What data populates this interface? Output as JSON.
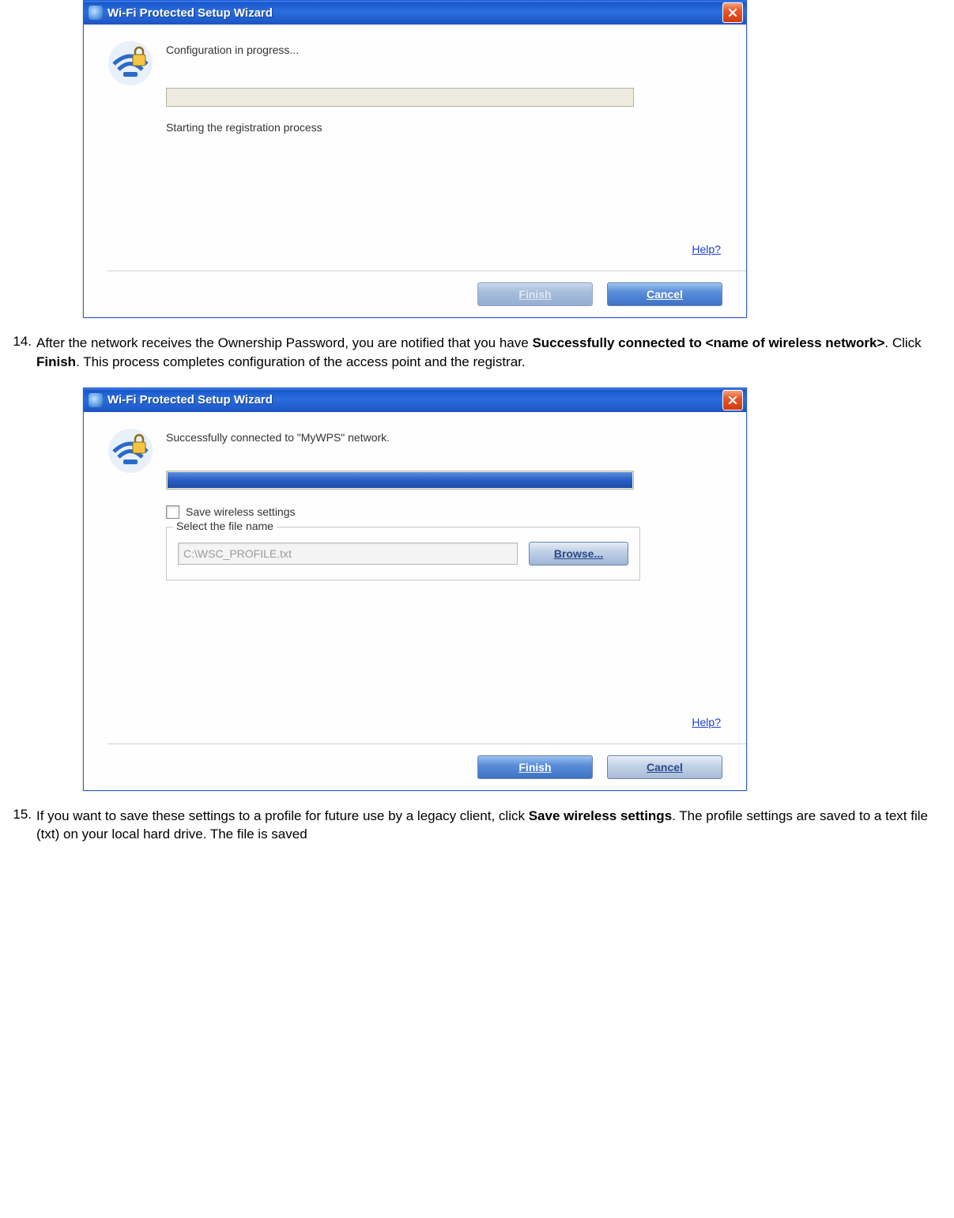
{
  "window1": {
    "title": "Wi-Fi Protected Setup Wizard",
    "message": "Configuration in progress...",
    "status": "Starting the registration process",
    "help": "Help?",
    "finish": "Finish",
    "cancel": "Cancel"
  },
  "step14": {
    "num": "14.",
    "text_before": "After the network receives the Ownership Password, you are notified that you have ",
    "bold1": "Successfully connected to <name of wireless network>",
    "text_mid": ". Click ",
    "bold2": "Finish",
    "text_after": ". This process completes configuration of the access point and the registrar."
  },
  "window2": {
    "title": "Wi-Fi Protected Setup Wizard",
    "message": "Successfully connected to \"MyWPS\" network.",
    "checkbox_label": "Save wireless settings",
    "groupbox_title": "Select the file name",
    "file_value": "C:\\WSC_PROFILE.txt",
    "browse": "Browse...",
    "help": "Help?",
    "finish": "Finish",
    "cancel": "Cancel"
  },
  "step15": {
    "num": "15.",
    "text_before": "If you want to save these settings to a profile for future use by a legacy client, click ",
    "bold1": "Save wireless settings",
    "text_after": ". The profile settings are saved to a text file (txt) on your local hard drive. The file is saved"
  }
}
